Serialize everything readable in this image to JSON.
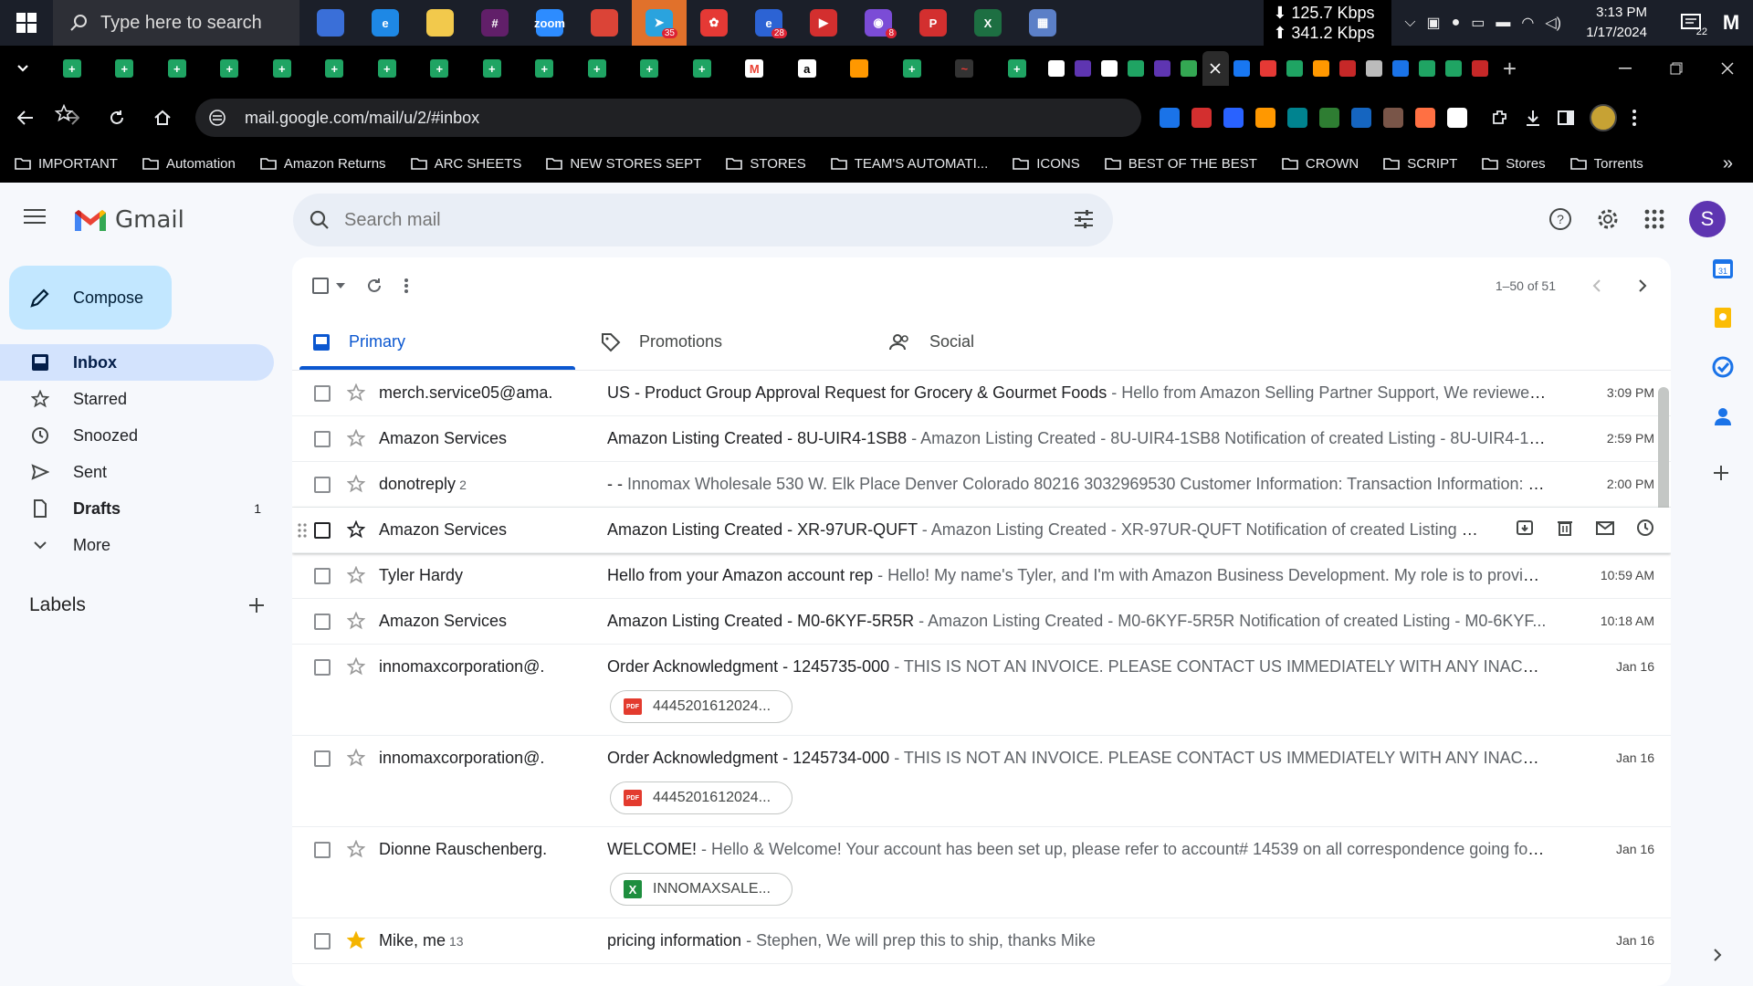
{
  "taskbar": {
    "search_placeholder": "Type here to search",
    "apps": [
      {
        "name": "widgets-icon",
        "color": "#3a6fd8",
        "glyph": "",
        "badge": ""
      },
      {
        "name": "edge-icon",
        "color": "#1e88e5",
        "glyph": "e",
        "badge": ""
      },
      {
        "name": "file-explorer-icon",
        "color": "#f2c94c",
        "glyph": "",
        "badge": ""
      },
      {
        "name": "slack-icon",
        "color": "#611f69",
        "glyph": "#",
        "badge": ""
      },
      {
        "name": "zoom-icon",
        "color": "#2d8cff",
        "glyph": "zoom",
        "badge": ""
      },
      {
        "name": "chrome-icon",
        "color": "#db4437",
        "glyph": "",
        "badge": ""
      },
      {
        "name": "telegram-icon",
        "color": "#2aa3de",
        "glyph": "➤",
        "badge": "35"
      },
      {
        "name": "cluster-app-icon",
        "color": "#e53935",
        "glyph": "✿",
        "badge": ""
      },
      {
        "name": "edge-beta-icon",
        "color": "#2c63d4",
        "glyph": "e",
        "badge": "28"
      },
      {
        "name": "pdf-app-icon",
        "color": "#d32f2f",
        "glyph": "▶",
        "badge": ""
      },
      {
        "name": "messenger-icon",
        "color": "#7b4cd6",
        "glyph": "◉",
        "badge": "8"
      },
      {
        "name": "p-app-icon",
        "color": "#d32f2f",
        "glyph": "P",
        "badge": ""
      },
      {
        "name": "excel-icon",
        "color": "#1d6f42",
        "glyph": "X",
        "badge": ""
      },
      {
        "name": "calculator-icon",
        "color": "#5b7fc7",
        "glyph": "▦",
        "badge": ""
      }
    ],
    "download_speed": "⬇ 125.7 Kbps",
    "upload_speed": "⬆ 341.2 Kbps",
    "time": "3:13 PM",
    "date": "1/17/2024",
    "notifications_count": "22",
    "user_initials": "M"
  },
  "browser": {
    "url": "mail.google.com/mail/u/2/#inbox",
    "bookmarks": [
      "IMPORTANT",
      "Automation",
      "Amazon Returns",
      "ARC SHEETS",
      "NEW STORES SEPT",
      "STORES",
      "TEAM'S AUTOMATI...",
      "ICONS",
      "BEST OF THE BEST",
      "CROWN",
      "SCRIPT",
      "Stores",
      "Torrents"
    ],
    "extensions_colors": [
      "#1a73e8",
      "#d32f2f",
      "#2962ff",
      "#ff9800",
      "#00838f",
      "#2e7d32",
      "#1565c0",
      "#795548",
      "#ff7043",
      "#ffffff"
    ]
  },
  "gmail": {
    "app_name": "Gmail",
    "search_placeholder": "Search mail",
    "account_initial": "S",
    "compose_label": "Compose",
    "nav": [
      {
        "label": "Inbox",
        "count": "",
        "active": true,
        "icon": "inbox-icon"
      },
      {
        "label": "Starred",
        "count": "",
        "active": false,
        "icon": "star-icon"
      },
      {
        "label": "Snoozed",
        "count": "",
        "active": false,
        "icon": "clock-icon"
      },
      {
        "label": "Sent",
        "count": "",
        "active": false,
        "icon": "send-icon"
      },
      {
        "label": "Drafts",
        "count": "1",
        "active": false,
        "icon": "draft-icon"
      },
      {
        "label": "More",
        "count": "",
        "active": false,
        "icon": "chevron-down-icon"
      }
    ],
    "labels_heading": "Labels",
    "pagination": "1–50 of 51",
    "tabs": [
      {
        "label": "Primary",
        "active": true
      },
      {
        "label": "Promotions",
        "active": false
      },
      {
        "label": "Social",
        "active": false
      }
    ],
    "emails": [
      {
        "sender": "merch.service05@ama.",
        "count": "",
        "subject": "US - Product Group Approval Request for Grocery & Gourmet Foods",
        "snippet": " - Hello from Amazon Selling Partner Support, We reviewed ...",
        "date": "3:09 PM",
        "starred": false,
        "attachment": "",
        "attachment_type": ""
      },
      {
        "sender": "Amazon Services",
        "count": "",
        "subject": "Amazon Listing Created - 8U-UIR4-1SB8",
        "snippet": " - Amazon Listing Created - 8U-UIR4-1SB8 Notification of created Listing - 8U-UIR4-1SB...",
        "date": "2:59 PM",
        "starred": false,
        "attachment": "",
        "attachment_type": ""
      },
      {
        "sender": "donotreply",
        "count": "2",
        "subject": "- -",
        "snippet": " Innomax Wholesale 530 W. Elk Place Denver Colorado 80216 3032969530 Customer Information: Transaction Information: Str...",
        "date": "2:00 PM",
        "starred": false,
        "attachment": "",
        "attachment_type": ""
      },
      {
        "sender": "Amazon Services",
        "count": "",
        "subject": "Amazon Listing Created - XR-97UR-QUFT",
        "snippet": " - Amazon Listing Created - XR-97UR-QUFT Notification of created Listing -...",
        "date": "",
        "starred": false,
        "attachment": "",
        "attachment_type": "",
        "hover": true
      },
      {
        "sender": "Tyler Hardy",
        "count": "",
        "subject": "Hello from your Amazon account rep",
        "snippet": " - Hello! My name's Tyler, and I'm with Amazon Business Development. My role is to provide ...",
        "date": "10:59 AM",
        "starred": false,
        "attachment": "",
        "attachment_type": ""
      },
      {
        "sender": "Amazon Services",
        "count": "",
        "subject": "Amazon Listing Created - M0-6KYF-5R5R",
        "snippet": " - Amazon Listing Created - M0-6KYF-5R5R Notification of created Listing - M0-6KYF...",
        "date": "10:18 AM",
        "starred": false,
        "attachment": "",
        "attachment_type": ""
      },
      {
        "sender": "innomaxcorporation@.",
        "count": "",
        "subject": "Order Acknowledgment - 1245735-000",
        "snippet": " - THIS IS NOT AN INVOICE. PLEASE CONTACT US IMMEDIATELY WITH ANY INACCURACI...",
        "date": "Jan 16",
        "starred": false,
        "attachment": "4445201612024...",
        "attachment_type": "pdf"
      },
      {
        "sender": "innomaxcorporation@.",
        "count": "",
        "subject": "Order Acknowledgment - 1245734-000",
        "snippet": " - THIS IS NOT AN INVOICE. PLEASE CONTACT US IMMEDIATELY WITH ANY INACCURACI...",
        "date": "Jan 16",
        "starred": false,
        "attachment": "4445201612024...",
        "attachment_type": "pdf"
      },
      {
        "sender": "Dionne Rauschenberg.",
        "count": "",
        "subject": "WELCOME!",
        "snippet": " - Hello & Welcome! Your account has been set up, please refer to account# 14539 on all correspondence going forw...",
        "date": "Jan 16",
        "starred": false,
        "attachment": "INNOMAXSALE...",
        "attachment_type": "xls"
      },
      {
        "sender": "Mike, me",
        "count": "13",
        "subject": "pricing information",
        "snippet": " - Stephen, We will prep this to ship, thanks Mike",
        "date": "Jan 16",
        "starred": true,
        "attachment": "",
        "attachment_type": ""
      }
    ]
  }
}
